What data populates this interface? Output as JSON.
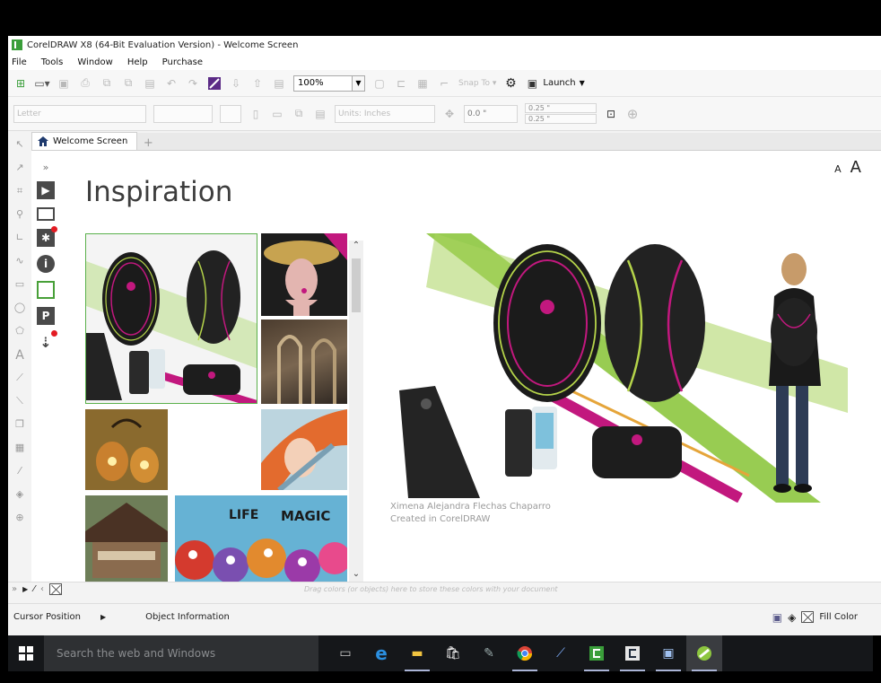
{
  "window": {
    "title": "CorelDRAW X8 (64-Bit Evaluation Version) - Welcome Screen"
  },
  "menu": [
    "File",
    "Tools",
    "Window",
    "Help",
    "Purchase"
  ],
  "toolbar": {
    "zoom": "100%",
    "snap_label": "Snap To",
    "launch_label": "Launch"
  },
  "property_bar": {
    "page_size": "Letter",
    "units": "Units: Inches",
    "nudge": "0.0 \"",
    "dup_x": "0.25 \"",
    "dup_y": "0.25 \""
  },
  "tab": {
    "label": "Welcome Screen"
  },
  "welcome": {
    "heading": "Inspiration",
    "font_small": "A",
    "font_large": "A",
    "credit_name": "Ximena Alejandra Flechas Chaparro",
    "credit_note": "Created in CorelDRAW"
  },
  "palette": {
    "hint": "Drag colors (or objects) here to store these colors with your document"
  },
  "status": {
    "cursor_position": "Cursor Position",
    "object_information": "Object Information",
    "fill_color": "Fill Color"
  },
  "taskbar": {
    "search_placeholder": "Search the web and Windows",
    "accent": "#aab4d6"
  },
  "colors": {
    "corel_green": "#48a038",
    "magenta": "#c2187e",
    "lime": "#8dc63f"
  }
}
